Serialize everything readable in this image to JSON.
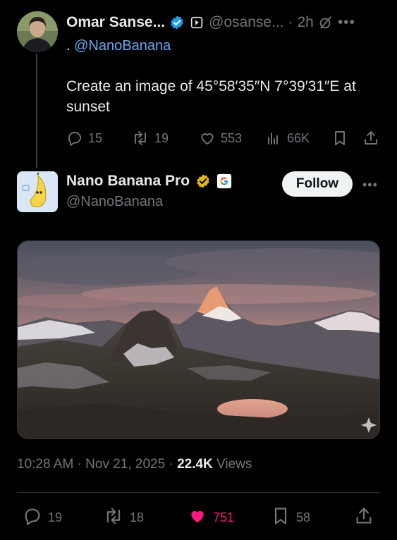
{
  "reply_tweet": {
    "author_name": "Omar Sanse...",
    "handle": "@osanse...",
    "time": "· 2h",
    "reply_prefix": ".",
    "mention": "@NanoBanana",
    "text": "Create an image of 45°58′35″N 7°39′31″E at sunset",
    "stats": {
      "replies": "15",
      "reposts": "19",
      "likes": "553",
      "views": "66K"
    }
  },
  "main_tweet": {
    "author_name": "Nano Banana Pro",
    "handle": "@NanoBanana",
    "follow_label": "Follow",
    "image_alt": "Matterhorn at sunset above an alpine lake",
    "timestamp": "10:28 AM · Nov 21, 2025 · ",
    "views_count": "22.4K",
    "views_label": " Views",
    "stats": {
      "replies": "19",
      "reposts": "18",
      "likes": "751",
      "bookmarks": "58"
    }
  },
  "colors": {
    "background": "#000000",
    "text_primary": "#e7e9ea",
    "text_muted": "#71767b",
    "link": "#6aa8f0",
    "verified_blue": "#1d9bf0",
    "verified_gold": "#e2b719",
    "like_pink": "#f91880"
  },
  "icons": [
    "verified-badge-icon",
    "subscribe-icon",
    "grok-icon",
    "more-icon",
    "reply-icon",
    "repost-icon",
    "like-icon",
    "views-icon",
    "bookmark-icon",
    "share-icon",
    "google-icon",
    "sparkle-icon"
  ]
}
